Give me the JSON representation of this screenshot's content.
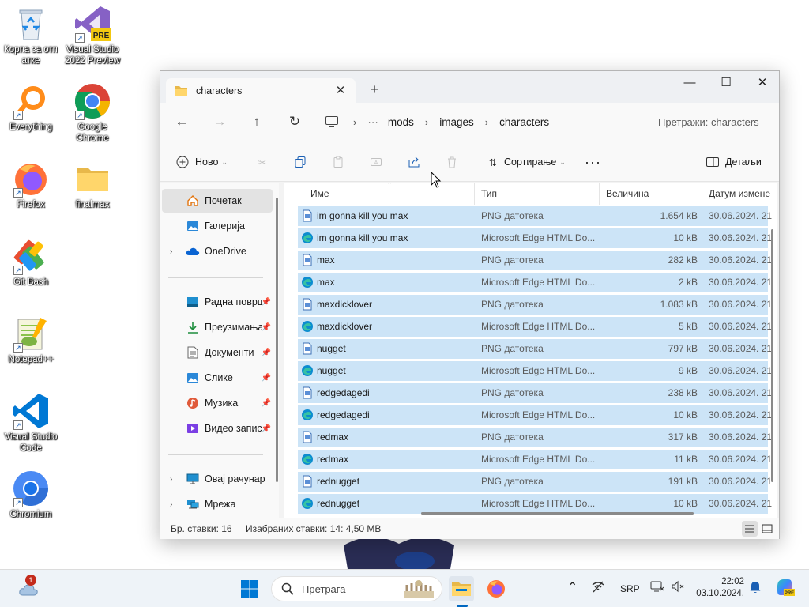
{
  "desktop": {
    "icons": [
      {
        "label": "Корпа за отп\nатке",
        "icon": "recycle-bin-icon"
      },
      {
        "label": "Visual Studio\n2022 Preview",
        "icon": "visual-studio-icon",
        "badge": "PRE"
      },
      {
        "label": "Everything",
        "icon": "everything-search-icon"
      },
      {
        "label": "Google\nChrome",
        "icon": "chrome-icon"
      },
      {
        "label": "Firefox",
        "icon": "firefox-icon"
      },
      {
        "label": "finalmax",
        "icon": "folder-icon"
      },
      {
        "label": "Git Bash",
        "icon": "git-bash-icon"
      },
      {
        "label": "Notepad++",
        "icon": "notepadpp-icon"
      },
      {
        "label": "Visual Studio\nCode",
        "icon": "vscode-icon"
      },
      {
        "label": "Chromium",
        "icon": "chromium-icon"
      }
    ]
  },
  "window": {
    "tab_title": "characters",
    "breadcrumb": [
      "mods",
      "images",
      "characters"
    ],
    "search_placeholder": "Претражи: characters",
    "toolbar": {
      "new_label": "Ново",
      "sort_label": "Сортирање",
      "details_label": "Детаљи"
    },
    "sidebar": {
      "items": [
        {
          "label": "Почетак",
          "icon": "home-icon",
          "selected": true
        },
        {
          "label": "Галерија",
          "icon": "gallery-icon"
        },
        {
          "label": "OneDrive",
          "icon": "onedrive-icon",
          "expandable": true
        },
        {
          "label": "Радна површ",
          "icon": "desktop-icon",
          "pinned": true
        },
        {
          "label": "Преузимања",
          "icon": "download-icon",
          "pinned": true
        },
        {
          "label": "Документи",
          "icon": "documents-icon",
          "pinned": true
        },
        {
          "label": "Слике",
          "icon": "pictures-icon",
          "pinned": true
        },
        {
          "label": "Музика",
          "icon": "music-icon",
          "pinned": true
        },
        {
          "label": "Видео записи",
          "icon": "videos-icon",
          "pinned": true
        },
        {
          "label": "Овај рачунар",
          "icon": "this-pc-icon",
          "expandable": true
        },
        {
          "label": "Мрежа",
          "icon": "network-icon",
          "expandable": true
        }
      ]
    },
    "columns": [
      "Име",
      "Тип",
      "Величина",
      "Датум измене"
    ],
    "files": [
      {
        "name": "im gonna kill you max",
        "type": "PNG датотека",
        "size": "1.654 kB",
        "date": "30.06.2024. 21",
        "kind": "png"
      },
      {
        "name": "im gonna kill you max",
        "type": "Microsoft Edge HTML Do...",
        "size": "10 kB",
        "date": "30.06.2024. 21",
        "kind": "html"
      },
      {
        "name": "max",
        "type": "PNG датотека",
        "size": "282 kB",
        "date": "30.06.2024. 21",
        "kind": "png"
      },
      {
        "name": "max",
        "type": "Microsoft Edge HTML Do...",
        "size": "2 kB",
        "date": "30.06.2024. 21",
        "kind": "html"
      },
      {
        "name": "maxdicklover",
        "type": "PNG датотека",
        "size": "1.083 kB",
        "date": "30.06.2024. 21",
        "kind": "png"
      },
      {
        "name": "maxdicklover",
        "type": "Microsoft Edge HTML Do...",
        "size": "5 kB",
        "date": "30.06.2024. 21",
        "kind": "html"
      },
      {
        "name": "nugget",
        "type": "PNG датотека",
        "size": "797 kB",
        "date": "30.06.2024. 21",
        "kind": "png"
      },
      {
        "name": "nugget",
        "type": "Microsoft Edge HTML Do...",
        "size": "9 kB",
        "date": "30.06.2024. 21",
        "kind": "html"
      },
      {
        "name": "redgedagedi",
        "type": "PNG датотека",
        "size": "238 kB",
        "date": "30.06.2024. 21",
        "kind": "png"
      },
      {
        "name": "redgedagedi",
        "type": "Microsoft Edge HTML Do...",
        "size": "10 kB",
        "date": "30.06.2024. 21",
        "kind": "html"
      },
      {
        "name": "redmax",
        "type": "PNG датотека",
        "size": "317 kB",
        "date": "30.06.2024. 21",
        "kind": "png"
      },
      {
        "name": "redmax",
        "type": "Microsoft Edge HTML Do...",
        "size": "11 kB",
        "date": "30.06.2024. 21",
        "kind": "html"
      },
      {
        "name": "rednugget",
        "type": "PNG датотека",
        "size": "191 kB",
        "date": "30.06.2024. 21",
        "kind": "png"
      },
      {
        "name": "rednugget",
        "type": "Microsoft Edge HTML Do...",
        "size": "10 kB",
        "date": "30.06.2024. 21",
        "kind": "html"
      }
    ],
    "status": {
      "item_count": "Бр. ставки: 16",
      "selected": "Изабраних ставки: 14: 4,50 MB"
    }
  },
  "taskbar": {
    "search_placeholder": "Претрага",
    "widgets_badge": "1",
    "language": "SRP",
    "time": "22:02",
    "date": "03.10.2024."
  },
  "colors": {
    "selection": "#cce4f7",
    "accent": "#0067c0"
  }
}
